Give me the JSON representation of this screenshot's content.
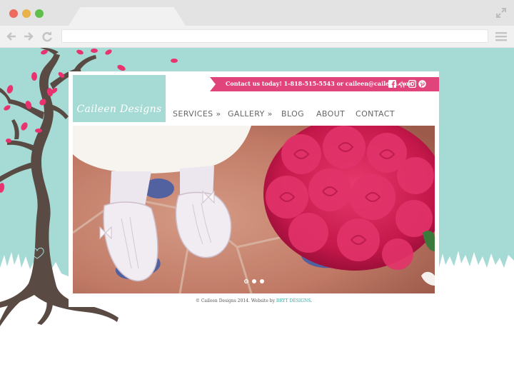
{
  "browser": {
    "url": "",
    "window_controls": [
      "close",
      "minimize",
      "maximize"
    ],
    "icons": [
      "back-arrow-icon",
      "forward-arrow-icon",
      "reload-icon",
      "menu-icon",
      "expand-icon"
    ]
  },
  "site": {
    "logo_text": "Caileen Designs",
    "contact_text": "Contact us today! 1-818-515-5543 or caileen@caileen.com",
    "social_icons": [
      "facebook-icon",
      "yelp-icon",
      "instagram-icon",
      "pinterest-icon"
    ],
    "nav": {
      "services": "SERVICES »",
      "gallery": "GALLERY »",
      "blog": "BLOG",
      "about": "ABOUT",
      "contact": "CONTACT"
    },
    "slider": {
      "slide_count": 3,
      "active_index": 0
    },
    "footer": {
      "text": "© Caileen Designs 2014. Website by ",
      "link": "BRYT DESIGNS",
      "suffix": "."
    }
  },
  "colors": {
    "teal": "#a6dad4",
    "pink": "#e0447a",
    "tree_brown": "#5a4a44",
    "leaf_pink": "#e8336f"
  }
}
